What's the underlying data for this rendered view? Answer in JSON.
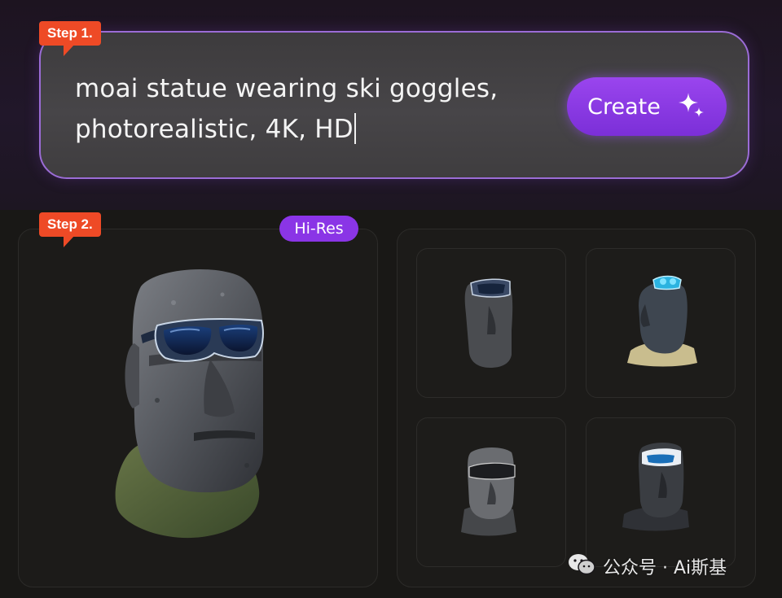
{
  "step1": {
    "label": "Step 1."
  },
  "step2": {
    "label": "Step 2."
  },
  "prompt": {
    "line1": "moai statue wearing ski goggles,",
    "line2": "photorealistic, 4K, HD"
  },
  "create_button": {
    "label": "Create",
    "icon": "sparkle-icon"
  },
  "hires_badge": {
    "label": "Hi-Res"
  },
  "main_image": {
    "subject": "moai-statue-with-goggles"
  },
  "thumbnails": [
    {
      "id": "variant-1"
    },
    {
      "id": "variant-2"
    },
    {
      "id": "variant-3"
    },
    {
      "id": "variant-4"
    }
  ],
  "watermark": {
    "text": "公众号 · Ai斯基",
    "icon": "wechat-icon"
  },
  "colors": {
    "accent_purple": "#8a35e6",
    "step_tag_orange": "#ee4a26",
    "prompt_border": "#9b6cd6",
    "goggle_blue": "#3ab8e8"
  }
}
